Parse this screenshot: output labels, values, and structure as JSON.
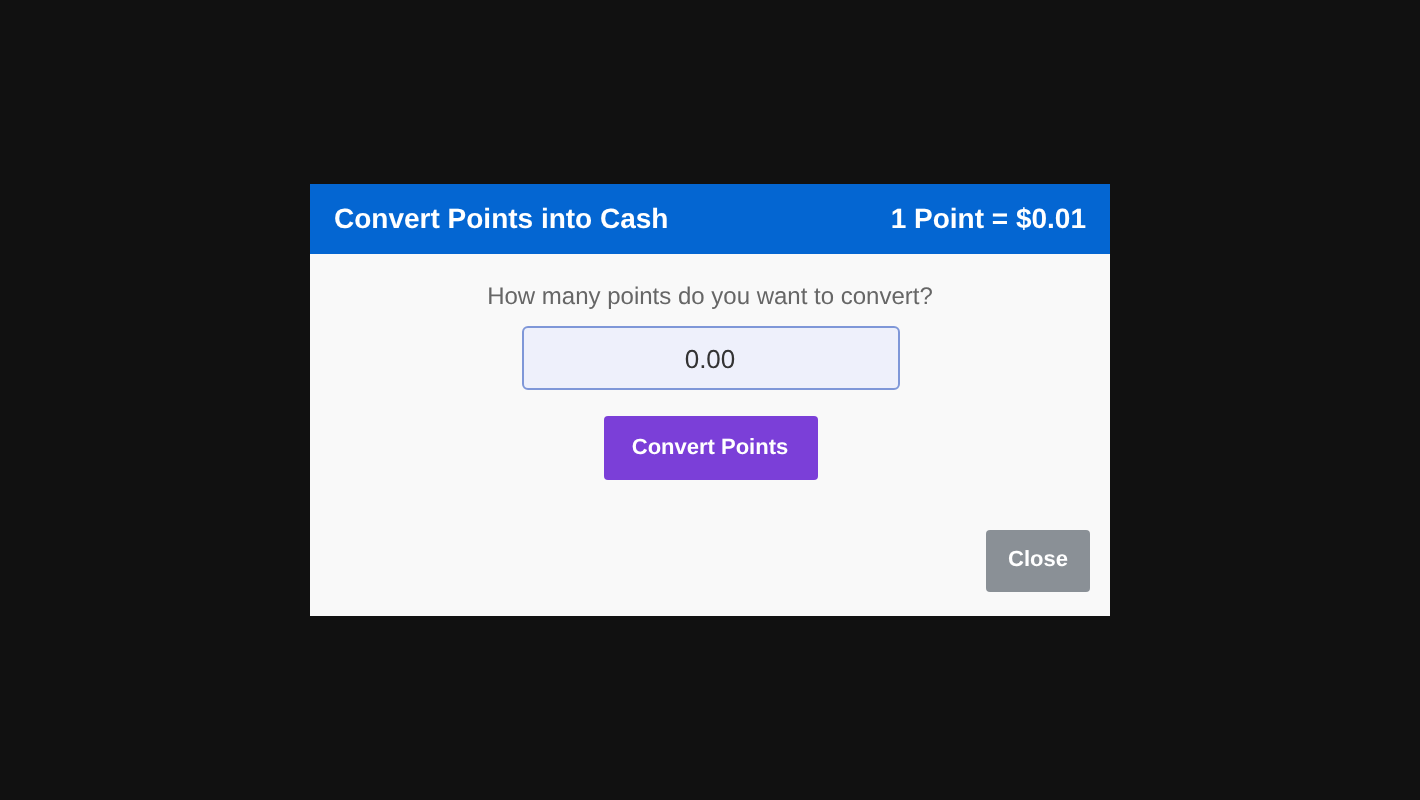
{
  "dialog": {
    "title": "Convert Points into Cash",
    "rate": "1 Point = $0.01",
    "question": "How many points do you want to convert?",
    "points_field": {
      "value": "0.00"
    },
    "buttons": [
      {
        "kind": "primary",
        "label": "Convert Points"
      },
      {
        "kind": "secondary",
        "label": "Close"
      }
    ]
  }
}
